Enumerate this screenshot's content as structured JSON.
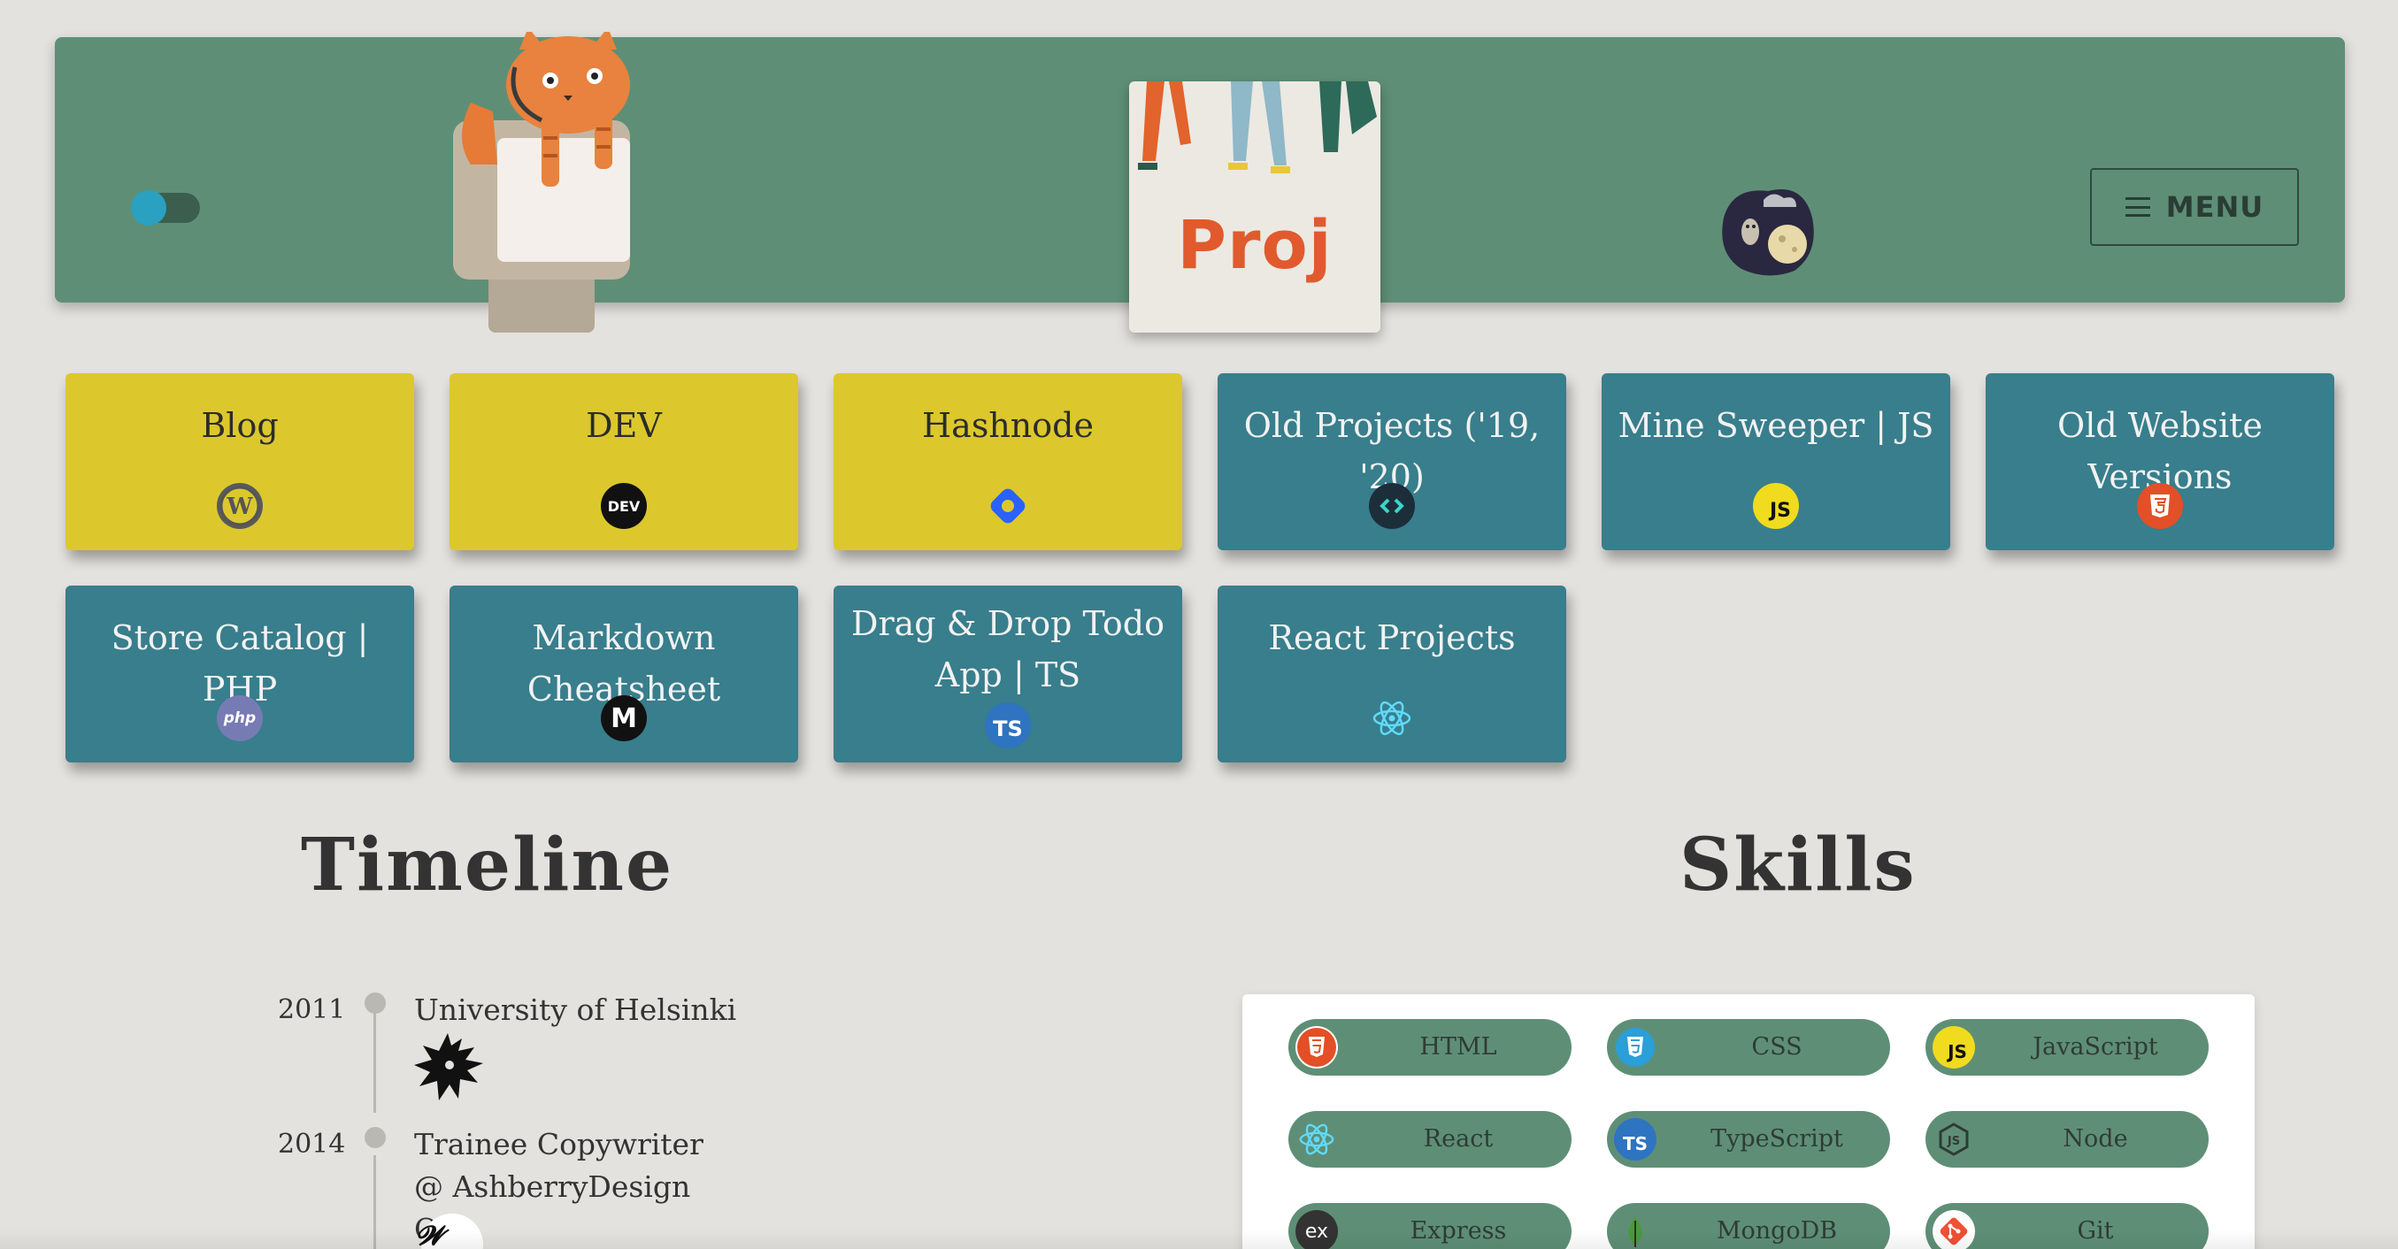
{
  "header": {
    "proj_card_text": "Proj",
    "menu_label": "MENU",
    "colors": {
      "header_bg": "#5e8f76",
      "toggle_knob": "#2aa1c0"
    }
  },
  "projects": [
    {
      "label": "Blog",
      "icon": "wordpress-icon",
      "color": "yellow"
    },
    {
      "label": "DEV",
      "icon": "dev-icon",
      "icon_text": "DEV",
      "color": "yellow"
    },
    {
      "label": "Hashnode",
      "icon": "hashnode-icon",
      "color": "yellow"
    },
    {
      "label": "Old Projects ('19, '20)",
      "icon": "code-icon",
      "color": "teal"
    },
    {
      "label": "Mine Sweeper | JS",
      "icon": "javascript-icon",
      "icon_text": "JS",
      "color": "teal"
    },
    {
      "label": "Old Website Versions",
      "icon": "html5-icon",
      "color": "teal"
    },
    {
      "label": "Store Catalog | PHP",
      "icon": "php-icon",
      "icon_text": "php",
      "color": "teal"
    },
    {
      "label": "Markdown Cheatsheet",
      "icon": "markdown-icon",
      "icon_text": "M",
      "color": "teal"
    },
    {
      "label": "Drag & Drop Todo App | TS",
      "icon": "typescript-icon",
      "icon_text": "TS",
      "color": "teal"
    },
    {
      "label": "React Projects",
      "icon": "react-icon",
      "color": "teal"
    }
  ],
  "timeline": {
    "title": "Timeline",
    "entries": [
      {
        "year": "2011",
        "text": "University of Helsinki",
        "icon": "university-logo-icon"
      },
      {
        "year": "2014",
        "text": "Trainee Copywriter @ AshberryDesign Oy",
        "icon": "ashberry-logo-icon"
      }
    ]
  },
  "skills": {
    "title": "Skills",
    "items": [
      {
        "name": "HTML",
        "icon": "html5-icon"
      },
      {
        "name": "CSS",
        "icon": "css3-icon"
      },
      {
        "name": "JavaScript",
        "icon": "javascript-icon",
        "icon_text": "JS"
      },
      {
        "name": "React",
        "icon": "react-icon"
      },
      {
        "name": "TypeScript",
        "icon": "typescript-icon",
        "icon_text": "TS"
      },
      {
        "name": "Node",
        "icon": "nodejs-icon",
        "icon_text": "JS"
      },
      {
        "name": "Express",
        "icon": "express-icon",
        "icon_text": "ex"
      },
      {
        "name": "MongoDB",
        "icon": "mongodb-icon"
      },
      {
        "name": "Git",
        "icon": "git-icon"
      }
    ]
  }
}
